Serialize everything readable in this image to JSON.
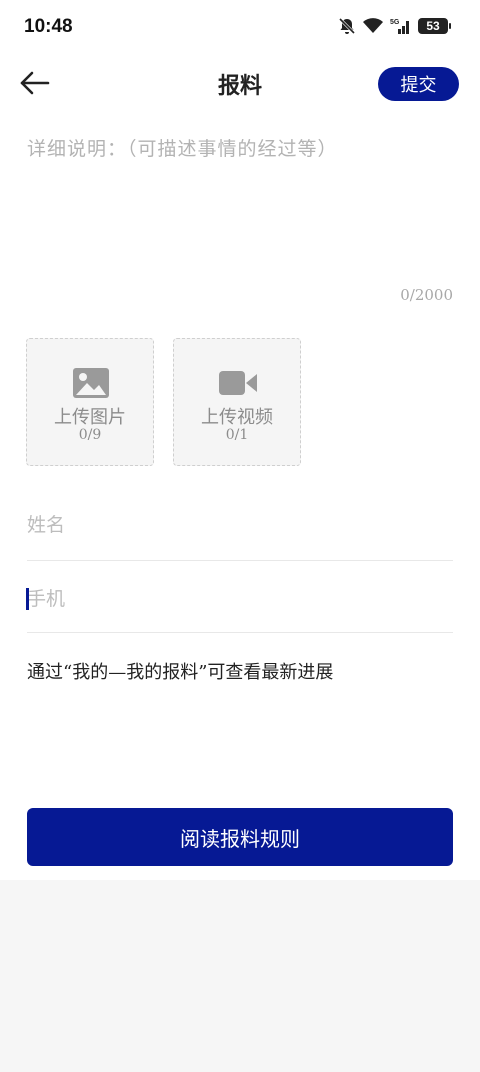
{
  "status_bar": {
    "time": "10:48",
    "battery_level": "53"
  },
  "header": {
    "title": "报料",
    "submit_label": "提交"
  },
  "description": {
    "placeholder": "详细说明：（可描述事情的经过等）",
    "counter": "0/2000"
  },
  "uploads": [
    {
      "label": "上传图片",
      "count": "0/9",
      "icon": "image-icon"
    },
    {
      "label": "上传视频",
      "count": "0/1",
      "icon": "video-camera-icon"
    }
  ],
  "form": {
    "name_placeholder": "姓名",
    "phone_placeholder": "手机"
  },
  "hint": "通过“我的—我的报料”可查看最新进展",
  "rules_button_label": "阅读报料规则",
  "colors": {
    "accent": "#061994",
    "placeholder": "#b3b3b3",
    "upload_bg": "#f5f5f5"
  }
}
